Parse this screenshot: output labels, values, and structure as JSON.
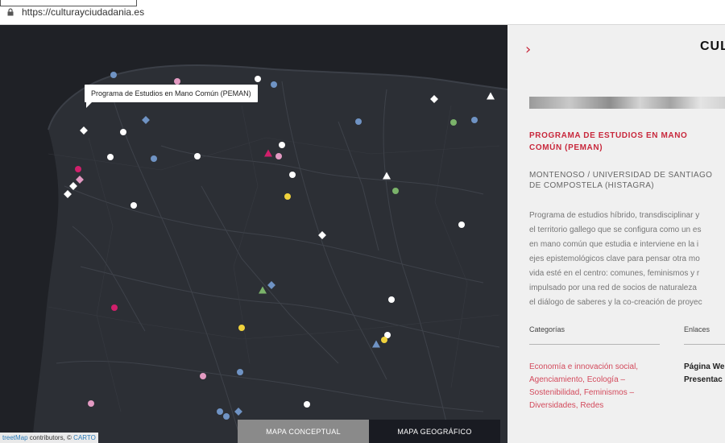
{
  "browser": {
    "url": "https://culturayciudadania.es"
  },
  "map": {
    "tooltip": "Programa de Estudios en Mano Común (PEMAN)",
    "attribution_prefix": "treetMap",
    "attribution_middle": " contributors, © ",
    "attribution_carto": "CARTO",
    "toggle": {
      "conceptual": "MAPA CONCEPTUAL",
      "geographic": "MAPA GEOGRÁFICO",
      "active": "conceptual"
    },
    "colors": {
      "white": "#ffffff",
      "blue": "#6f93c4",
      "pink": "#e39ac2",
      "magenta": "#d01f6b",
      "yellow": "#f0d23c",
      "green": "#7bb36a"
    },
    "markers": [
      {
        "shape": "circle",
        "color": "blue"
      },
      {
        "shape": "circle",
        "color": "pink"
      },
      {
        "shape": "circle",
        "color": "white"
      },
      {
        "shape": "circle",
        "color": "blue"
      },
      {
        "shape": "diamond",
        "color": "white"
      },
      {
        "shape": "triangle",
        "color": "white"
      },
      {
        "shape": "diamond",
        "color": "white"
      },
      {
        "shape": "circle",
        "color": "white"
      },
      {
        "shape": "diamond",
        "color": "blue"
      },
      {
        "shape": "circle",
        "color": "blue"
      },
      {
        "shape": "circle",
        "color": "green"
      },
      {
        "shape": "circle",
        "color": "blue"
      },
      {
        "shape": "circle",
        "color": "white"
      },
      {
        "shape": "circle",
        "color": "blue"
      },
      {
        "shape": "circle",
        "color": "white"
      },
      {
        "shape": "circle",
        "color": "white"
      },
      {
        "shape": "triangle",
        "color": "magenta"
      },
      {
        "shape": "circle",
        "color": "pink"
      },
      {
        "shape": "circle",
        "color": "magenta"
      },
      {
        "shape": "diamond",
        "color": "pink"
      },
      {
        "shape": "diamond",
        "color": "white"
      },
      {
        "shape": "diamond",
        "color": "white"
      },
      {
        "shape": "circle",
        "color": "white"
      },
      {
        "shape": "triangle",
        "color": "white"
      },
      {
        "shape": "circle",
        "color": "yellow"
      },
      {
        "shape": "circle",
        "color": "green"
      },
      {
        "shape": "circle",
        "color": "white"
      },
      {
        "shape": "circle",
        "color": "white"
      },
      {
        "shape": "diamond",
        "color": "white"
      },
      {
        "shape": "triangle",
        "color": "green"
      },
      {
        "shape": "diamond",
        "color": "blue"
      },
      {
        "shape": "circle",
        "color": "white"
      },
      {
        "shape": "circle",
        "color": "magenta"
      },
      {
        "shape": "circle",
        "color": "yellow"
      },
      {
        "shape": "circle",
        "color": "white"
      },
      {
        "shape": "circle",
        "color": "yellow"
      },
      {
        "shape": "triangle",
        "color": "blue"
      },
      {
        "shape": "circle",
        "color": "pink"
      },
      {
        "shape": "circle",
        "color": "blue"
      },
      {
        "shape": "circle",
        "color": "pink"
      },
      {
        "shape": "circle",
        "color": "blue"
      },
      {
        "shape": "circle",
        "color": "blue"
      },
      {
        "shape": "diamond",
        "color": "blue"
      },
      {
        "shape": "circle",
        "color": "white"
      }
    ]
  },
  "panel": {
    "brand": "CUL",
    "title": "PROGRAMA DE ESTUDIOS EN MANO COMÚN (PEMAN)",
    "organization": "MONTENOSO / UNIVERSIDAD DE SANTIAGO DE COMPOSTELA (HISTAGRA)",
    "description": "Programa de estudios híbrido, transdisciplinar y\nel territorio gallego que se configura como un es\nen mano común que estudia e interviene en la i\nejes epistemológicos clave para pensar otra mo\nvida esté en el centro: comunes, feminismos y r\nimpulsado por una red de socios de naturaleza\nel diálogo de saberes y la co-creación de proyec",
    "categories_heading": "Categorías",
    "links_heading": "Enlaces",
    "categories": "Economía e innovación social, Agenciamiento, Ecología – Sostenibilidad, Feminismos – Diversidades, Redes",
    "links": [
      "Página We",
      "Presentac"
    ],
    "colors": {
      "accent": "#c8283c",
      "category_link": "#d34a5c"
    }
  }
}
